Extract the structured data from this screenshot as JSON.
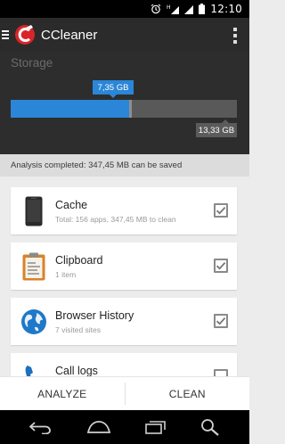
{
  "status_bar": {
    "time": "12:10",
    "icons": [
      "alarm-icon",
      "signal-h-icon",
      "wifi-signal-icon",
      "battery-icon"
    ]
  },
  "app_bar": {
    "title": "CCleaner",
    "menu_icon": "hamburger-icon",
    "logo": "ccleaner-logo",
    "overflow_icon": "overflow-menu-icon"
  },
  "storage": {
    "label": "Storage",
    "used": "7,35 GB",
    "total": "13,33 GB",
    "used_fraction": 0.53,
    "marker_fraction": 0.525,
    "colors": {
      "used": "#2b86d8",
      "free": "#595959",
      "total_badge": "#5b5b5b"
    }
  },
  "analysis": {
    "message": "Analysis completed: 347,45 MB can be saved"
  },
  "items": [
    {
      "title": "Cache",
      "subtitle": "Total: 156 apps, 347,45 MB to clean",
      "icon": "phone-icon",
      "checked": true
    },
    {
      "title": "Clipboard",
      "subtitle": "1 item",
      "icon": "clipboard-icon",
      "checked": true
    },
    {
      "title": "Browser History",
      "subtitle": "7 visited sites",
      "icon": "globe-icon",
      "checked": true
    },
    {
      "title": "Call logs",
      "subtitle": "",
      "icon": "phone-handset-icon",
      "checked": false
    }
  ],
  "actions": {
    "analyze": "ANALYZE",
    "clean": "CLEAN"
  },
  "nav_bar": {
    "icons": [
      "back-icon",
      "home-icon",
      "recent-apps-icon",
      "search-icon"
    ]
  },
  "colors": {
    "app_bar": "#2b2b2b",
    "storage_bg": "#2d2d2d",
    "accent": "#2b86d8",
    "background": "#ececec"
  }
}
